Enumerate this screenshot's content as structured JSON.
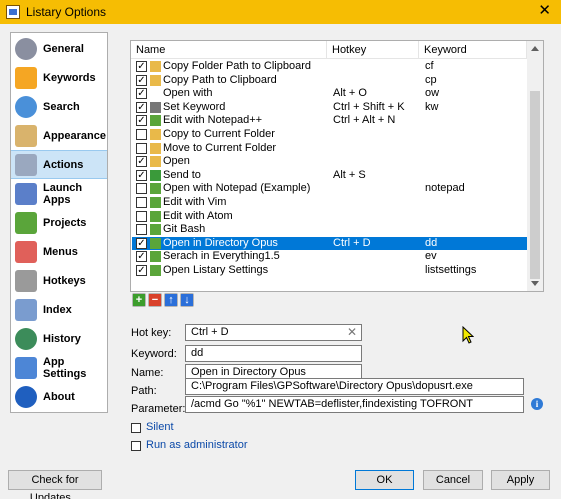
{
  "window": {
    "title": "Listary Options",
    "close_glyph": "✕"
  },
  "sidebar": {
    "items": [
      {
        "label": "General",
        "icon": "gear-icon",
        "color": "#8a8fa0"
      },
      {
        "label": "Keywords",
        "icon": "abc-icon",
        "color": "#f5a623"
      },
      {
        "label": "Search",
        "icon": "magnifier-icon",
        "color": "#4a90d9"
      },
      {
        "label": "Appearance",
        "icon": "palette-icon",
        "color": "#d9b36c"
      },
      {
        "label": "Actions",
        "icon": "actions-icon",
        "color": "#9aa8bf"
      },
      {
        "label": "Launch Apps",
        "icon": "launch-apps-icon",
        "color": "#5b7fc9"
      },
      {
        "label": "Projects",
        "icon": "puzzle-icon",
        "color": "#5aa53a"
      },
      {
        "label": "Menus",
        "icon": "menu-heart-icon",
        "color": "#e0605a"
      },
      {
        "label": "Hotkeys",
        "icon": "keyboard-icon",
        "color": "#9a9a9a"
      },
      {
        "label": "Index",
        "icon": "index-icon",
        "color": "#7a9ccf"
      },
      {
        "label": "History",
        "icon": "clock-icon",
        "color": "#3c8c5a"
      },
      {
        "label": "App Settings",
        "icon": "app-settings-icon",
        "color": "#4d86d6"
      },
      {
        "label": "About",
        "icon": "info-icon",
        "color": "#1f5fbf"
      }
    ],
    "selected": "Actions"
  },
  "actions_list": {
    "columns": {
      "name": "Name",
      "hotkey": "Hotkey",
      "keyword": "Keyword"
    },
    "rows": [
      {
        "checked": true,
        "icon": "folder-clipboard-icon",
        "icon_color": "#e9b949",
        "name": "Copy Folder Path to Clipboard",
        "hotkey": "",
        "keyword": "cf",
        "selected": false
      },
      {
        "checked": true,
        "icon": "clipboard-icon",
        "icon_color": "#e9b949",
        "name": "Copy Path to Clipboard",
        "hotkey": "",
        "keyword": "cp",
        "selected": false
      },
      {
        "checked": true,
        "icon": "",
        "icon_color": "",
        "name": "Open with",
        "hotkey": "Alt + O",
        "keyword": "ow",
        "selected": false
      },
      {
        "checked": true,
        "icon": "keyword-icon",
        "icon_color": "#777777",
        "name": "Set Keyword",
        "hotkey": "Ctrl + Shift + K",
        "keyword": "kw",
        "selected": false
      },
      {
        "checked": true,
        "icon": "puzzle-icon",
        "icon_color": "#5aa53a",
        "name": "Edit with Notepad++",
        "hotkey": "Ctrl + Alt + N",
        "keyword": "",
        "selected": false
      },
      {
        "checked": false,
        "icon": "copy-folder-icon",
        "icon_color": "#e9b949",
        "name": "Copy to Current Folder",
        "hotkey": "",
        "keyword": "",
        "selected": false
      },
      {
        "checked": false,
        "icon": "move-folder-icon",
        "icon_color": "#e9b949",
        "name": "Move to Current Folder",
        "hotkey": "",
        "keyword": "",
        "selected": false
      },
      {
        "checked": true,
        "icon": "open-folder-icon",
        "icon_color": "#e9b949",
        "name": "Open",
        "hotkey": "",
        "keyword": "",
        "selected": false
      },
      {
        "checked": true,
        "icon": "send-to-icon",
        "icon_color": "#3a9a3a",
        "name": "Send to",
        "hotkey": "Alt + S",
        "keyword": "",
        "selected": false
      },
      {
        "checked": false,
        "icon": "puzzle-icon",
        "icon_color": "#5aa53a",
        "name": "Open with Notepad (Example)",
        "hotkey": "",
        "keyword": "notepad",
        "selected": false
      },
      {
        "checked": false,
        "icon": "puzzle-icon",
        "icon_color": "#5aa53a",
        "name": "Edit with Vim",
        "hotkey": "",
        "keyword": "",
        "selected": false
      },
      {
        "checked": false,
        "icon": "puzzle-icon",
        "icon_color": "#5aa53a",
        "name": "Edit with Atom",
        "hotkey": "",
        "keyword": "",
        "selected": false
      },
      {
        "checked": false,
        "icon": "puzzle-icon",
        "icon_color": "#5aa53a",
        "name": "Git Bash",
        "hotkey": "",
        "keyword": "",
        "selected": false
      },
      {
        "checked": true,
        "icon": "puzzle-icon",
        "icon_color": "#5aa53a",
        "name": "Open in Directory Opus",
        "hotkey": "Ctrl + D",
        "keyword": "dd",
        "selected": true
      },
      {
        "checked": true,
        "icon": "puzzle-icon",
        "icon_color": "#5aa53a",
        "name": "Serach in Everything1.5",
        "hotkey": "",
        "keyword": "ev",
        "selected": false
      },
      {
        "checked": true,
        "icon": "puzzle-icon",
        "icon_color": "#5aa53a",
        "name": "Open Listary Settings",
        "hotkey": "",
        "keyword": "listsettings",
        "selected": false
      }
    ],
    "toolbar": [
      {
        "icon": "add-icon",
        "glyph": "+",
        "color": "#3c9d2c"
      },
      {
        "icon": "remove-icon",
        "glyph": "−",
        "color": "#d9412b"
      },
      {
        "icon": "move-up-icon",
        "glyph": "↑",
        "color": "#2b6fd9"
      },
      {
        "icon": "move-down-icon",
        "glyph": "↓",
        "color": "#2b6fd9"
      }
    ]
  },
  "details": {
    "hotkey_label": "Hot key:",
    "hotkey_value": "Ctrl + D",
    "keyword_label": "Keyword:",
    "keyword_value": "dd",
    "name_label": "Name:",
    "name_value": "Open in Directory Opus",
    "path_label": "Path:",
    "path_value": "C:\\Program Files\\GPSoftware\\Directory Opus\\dopusrt.exe",
    "parameter_label": "Parameter:",
    "parameter_value": "/acmd Go \"%1\" NEWTAB=deflister,findexisting TOFRONT",
    "silent_label": "Silent",
    "silent_checked": false,
    "run_as_admin_label": "Run as administrator",
    "run_as_admin_checked": false
  },
  "buttons": {
    "check_updates": "Check for Updates...",
    "ok": "OK",
    "cancel": "Cancel",
    "apply": "Apply"
  },
  "colors": {
    "titlebar": "#f6bd03",
    "selection": "#0078d7",
    "sidebar_selection": "#cce4f7"
  }
}
